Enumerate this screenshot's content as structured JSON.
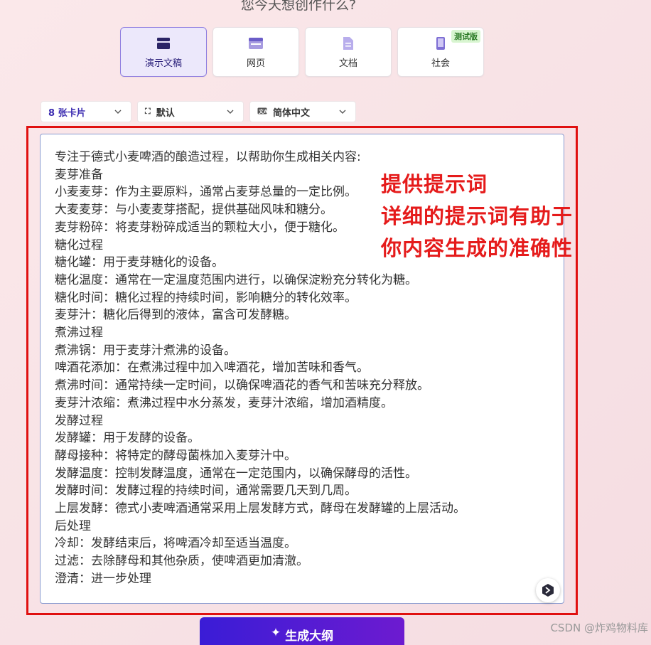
{
  "header": {
    "question": "您今天想创作什么?"
  },
  "types": [
    {
      "label": "演示文稿",
      "icon": "presentation-icon",
      "active": true
    },
    {
      "label": "网页",
      "icon": "webpage-icon",
      "active": false
    },
    {
      "label": "文档",
      "icon": "document-icon",
      "active": false
    },
    {
      "label": "社会",
      "icon": "social-phone-icon",
      "active": false,
      "badge": "测试版"
    }
  ],
  "options": {
    "cards": "8 张卡片",
    "layout": "默认",
    "language": "简体中文"
  },
  "prompt": {
    "lines": [
      "专注于德式小麦啤酒的酿造过程，以帮助你生成相关内容:",
      "麦芽准备",
      "小麦麦芽：作为主要原料，通常占麦芽总量的一定比例。",
      "大麦麦芽：与小麦麦芽搭配，提供基础风味和糖分。",
      "麦芽粉碎：将麦芽粉碎成适当的颗粒大小，便于糖化。",
      "糖化过程",
      "糖化罐：用于麦芽糖化的设备。",
      "糖化温度：通常在一定温度范围内进行，以确保淀粉充分转化为糖。",
      "糖化时间：糖化过程的持续时间，影响糖分的转化效率。",
      "麦芽汁：糖化后得到的液体，富含可发酵糖。",
      "煮沸过程",
      "煮沸锅：用于麦芽汁煮沸的设备。",
      "啤酒花添加：在煮沸过程中加入啤酒花，增加苦味和香气。",
      "煮沸时间：通常持续一定时间，以确保啤酒花的香气和苦味充分释放。",
      "麦芽汁浓缩：煮沸过程中水分蒸发，麦芽汁浓缩，增加酒精度。",
      "发酵过程",
      "发酵罐：用于发酵的设备。",
      "酵母接种：将特定的酵母菌株加入麦芽汁中。",
      "发酵温度：控制发酵温度，通常在一定范围内，以确保酵母的活性。",
      "发酵时间：发酵过程的持续时间，通常需要几天到几周。",
      "上层发酵：德式小麦啤酒通常采用上层发酵方式，酵母在发酵罐的上层活动。",
      "后处理",
      "冷却：发酵结束后，将啤酒冷却至适当温度。",
      "过滤：去除酵母和其他杂质，使啤酒更加清澈。",
      "澄清：进一步处理"
    ]
  },
  "annotation": {
    "line1": "提供提示词",
    "line2": "详细的提示词有助于",
    "line3": "你内容生成的准确性"
  },
  "actions": {
    "generate": "生成大纲"
  },
  "watermark": "CSDN @炸鸡物料库",
  "colors": {
    "accent": "#4a1fd6",
    "annotation": "#e51b1b"
  }
}
